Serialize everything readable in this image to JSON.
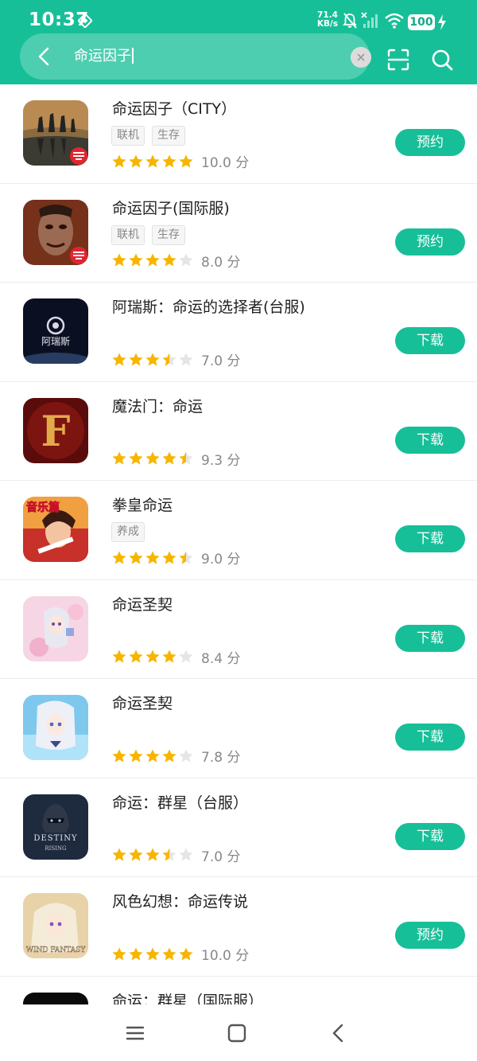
{
  "status_bar": {
    "time": "10:37",
    "net_speed_value": "71.4",
    "net_speed_unit": "KB/s",
    "battery": "100",
    "icons": [
      "vpn-icon",
      "mute-bell-icon",
      "no-signal-icon",
      "wifi-icon",
      "charging-icon"
    ]
  },
  "search": {
    "query": "命运因子",
    "icons": [
      "back-arrow-icon",
      "clear-icon",
      "scan-icon",
      "search-icon"
    ]
  },
  "colors": {
    "accent": "#17bf98",
    "star": "#f7b500",
    "star_empty": "#e5e5e5"
  },
  "results": [
    {
      "title": "命运因子（CITY）",
      "tags": [
        "联机",
        "生存"
      ],
      "rating": "10.0 分",
      "stars": 5,
      "action": "预约"
    },
    {
      "title": "命运因子(国际服)",
      "tags": [
        "联机",
        "生存"
      ],
      "rating": "8.0 分",
      "stars": 4,
      "action": "预约"
    },
    {
      "title": "阿瑞斯：命运的选择者(台服)",
      "tags": [],
      "rating": "7.0 分",
      "stars": 3.5,
      "action": "下载",
      "icon_text": "阿瑞斯"
    },
    {
      "title": "魔法门：命运",
      "tags": [],
      "rating": "9.3 分",
      "stars": 4.5,
      "action": "下载",
      "icon_text": "F"
    },
    {
      "title": "拳皇命运",
      "tags": [
        "养成"
      ],
      "rating": "9.0 分",
      "stars": 4.5,
      "action": "下载",
      "icon_text": "音乐篇"
    },
    {
      "title": "命运圣契",
      "tags": [],
      "rating": "8.4 分",
      "stars": 4,
      "action": "下载"
    },
    {
      "title": "命运圣契",
      "tags": [],
      "rating": "7.8 分",
      "stars": 4,
      "action": "下载"
    },
    {
      "title": "命运：群星（台服）",
      "tags": [],
      "rating": "7.0 分",
      "stars": 3.5,
      "action": "下载",
      "icon_text": "DESTINY",
      "icon_subtext": "RISING"
    },
    {
      "title": "风色幻想：命运传说",
      "tags": [],
      "rating": "10.0 分",
      "stars": 5,
      "action": "预约",
      "icon_text": "WIND FANTASY"
    },
    {
      "title": "命运：群星（国际服）"
    }
  ],
  "nav_bar": {
    "icons": [
      "menu-icon",
      "home-icon",
      "back-icon"
    ]
  }
}
